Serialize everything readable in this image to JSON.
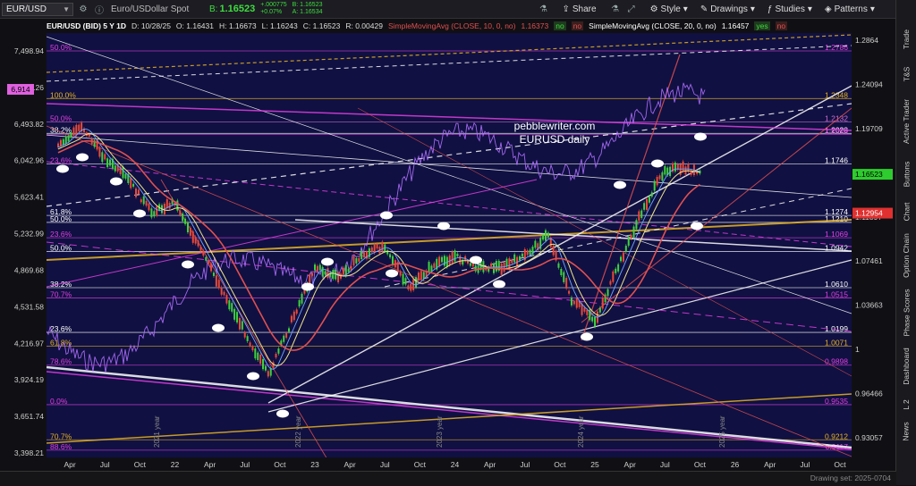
{
  "toolbar": {
    "symbol": "EUR/USD",
    "description": "Euro/USDollar Spot",
    "last_label": "B:",
    "last": "1.16523",
    "change": "+.000775",
    "change_pct": "+0.07%",
    "bid": "B: 1.16523",
    "ask": "A: 1.16534",
    "share": "Share",
    "style": "Style",
    "drawings": "Drawings",
    "studies": "Studies",
    "patterns": "Patterns"
  },
  "info": {
    "title": "EUR/USD (BID) 5 Y 1D",
    "date": "D: 10/28/25",
    "open": "O: 1.16431",
    "high": "H: 1.16673",
    "low": "L: 1.16243",
    "close": "C: 1.16523",
    "range": "R: 0.00429",
    "sma10": "SimpleMovingAvg (CLOSE, 10, 0, no)",
    "sma10_val": "1.16373",
    "sma20": "SimpleMovingAvg (CLOSE, 20, 0, no)",
    "sma20_val": "1.16457",
    "no1": "no",
    "no2": "no",
    "yes": "yes",
    "no3": "no"
  },
  "watermark": {
    "line1": "pebblewriter.com",
    "line2": "EURUSD daily"
  },
  "right_tabs": [
    "Trade",
    "T&S",
    "Active Trader",
    "Buttons",
    "Chart",
    "Option Chain",
    "Phase Scores",
    "Dashboard",
    "L 2",
    "News"
  ],
  "footer": {
    "drawing_set": "Drawing set: 2025-0704"
  },
  "colors": {
    "bg": "#101042",
    "candle_up": "#3fd23f",
    "candle_down": "#e84a3a",
    "sma10": "#6fa8ff",
    "sma20": "#f0e68c",
    "sma50": "#e05050",
    "spx": "#b070ff",
    "gold": "#e6b422",
    "white": "#ffffff",
    "magenta": "#e040e0"
  },
  "chart_data": {
    "type": "line",
    "series": [
      {
        "name": "EUR/USD",
        "x": [
          "2021-03",
          "2021-05",
          "2021-07",
          "2021-09",
          "2021-11",
          "2022-01",
          "2022-03",
          "2022-05",
          "2022-07",
          "2022-09",
          "2022-11",
          "2023-01",
          "2023-03",
          "2023-05",
          "2023-07",
          "2023-09",
          "2023-11",
          "2024-01",
          "2024-03",
          "2024-05",
          "2024-07",
          "2024-09",
          "2024-11",
          "2025-01",
          "2025-03",
          "2025-05",
          "2025-07",
          "2025-09",
          "2025-10"
        ],
        "values": [
          1.19,
          1.21,
          1.18,
          1.16,
          1.13,
          1.14,
          1.1,
          1.06,
          1.02,
          0.98,
          1.03,
          1.08,
          1.07,
          1.09,
          1.1,
          1.06,
          1.08,
          1.09,
          1.08,
          1.08,
          1.09,
          1.11,
          1.05,
          1.03,
          1.08,
          1.13,
          1.17,
          1.17,
          1.165
        ]
      }
    ],
    "right_axis_ticks": [
      "1.2864",
      "1.24094",
      "1.19709",
      "1.15478",
      "1.11397",
      "1.07461",
      "1.03663",
      "1",
      "0.96466",
      "0.93057"
    ],
    "left_axis_ticks": [
      "7,498.94",
      "6,878.26",
      "6,493.82",
      "6,042.96",
      "5,623.41",
      "5,232.99",
      "4,869.68",
      "4,531.58",
      "4,216.97",
      "3,924.19",
      "3,651.74",
      "3,398.21"
    ],
    "pink_label": "6,914",
    "x_ticks": [
      "Apr",
      "Jul",
      "Oct",
      "22",
      "Apr",
      "Jul",
      "Oct",
      "23",
      "Apr",
      "Jul",
      "Oct",
      "24",
      "Apr",
      "Jul",
      "Oct",
      "25",
      "Apr",
      "Jul",
      "Oct",
      "26",
      "Apr",
      "Jul",
      "Oct"
    ],
    "year_labels": [
      "2021 year",
      "2022 year",
      "2023 year",
      "2024 year",
      "2025 year"
    ],
    "price_levels": [
      {
        "label": "1.2786",
        "y": 1.2786,
        "color": "#e040e0"
      },
      {
        "label": "1.2348",
        "y": 1.2348,
        "color": "#e6b422"
      },
      {
        "label": "1.2132",
        "y": 1.2132,
        "color": "#d070d0"
      },
      {
        "label": "1.2028",
        "y": 1.2028,
        "color": "#ffffff"
      },
      {
        "label": "1.2018",
        "y": 1.2018,
        "color": "#e040e0"
      },
      {
        "label": "1.1746",
        "y": 1.1746,
        "color": "#ffffff"
      },
      {
        "label": "1.1274",
        "y": 1.1274,
        "color": "#ffffff"
      },
      {
        "label": "1.1210",
        "y": 1.121,
        "color": "#ffffff"
      },
      {
        "label": "1.1069",
        "y": 1.1069,
        "color": "#e040e0"
      },
      {
        "label": "1.0942",
        "y": 1.0942,
        "color": "#ffffff"
      },
      {
        "label": "1.0610",
        "y": 1.061,
        "color": "#ffffff"
      },
      {
        "label": "1.0515",
        "y": 1.0515,
        "color": "#e040e0"
      },
      {
        "label": "1.0199",
        "y": 1.0199,
        "color": "#ffffff"
      },
      {
        "label": "1.0071",
        "y": 1.0071,
        "color": "#e6b422"
      },
      {
        "label": "0.9898",
        "y": 0.9898,
        "color": "#e040e0"
      },
      {
        "label": "0.9535",
        "y": 0.9535,
        "color": "#e040e0"
      },
      {
        "label": "0.9212",
        "y": 0.9212,
        "color": "#e6b422"
      },
      {
        "label": "0.9117",
        "y": 0.9117,
        "color": "#e040e0"
      }
    ],
    "fib_labels": [
      {
        "label": "50.0%",
        "y": 1.2786,
        "color": "#e040e0"
      },
      {
        "label": "100.0%",
        "y": 1.2348,
        "color": "#e6b422"
      },
      {
        "label": "50.0%",
        "y": 1.2132,
        "color": "#e040e0"
      },
      {
        "label": "38.2%",
        "y": 1.2028,
        "color": "#ffffff"
      },
      {
        "label": "23.6%",
        "y": 1.1746,
        "color": "#e040e0"
      },
      {
        "label": "61.8%",
        "y": 1.1274,
        "color": "#ffffff"
      },
      {
        "label": "50.0%",
        "y": 1.121,
        "color": "#ffffff"
      },
      {
        "label": "23.6%",
        "y": 1.1069,
        "color": "#e040e0"
      },
      {
        "label": "50.0%",
        "y": 1.0942,
        "color": "#ffffff"
      },
      {
        "label": "38.2%",
        "y": 1.061,
        "color": "#ffffff"
      },
      {
        "label": "70.7%",
        "y": 1.0515,
        "color": "#e040e0"
      },
      {
        "label": "23.6%",
        "y": 1.0199,
        "color": "#ffffff"
      },
      {
        "label": "61.8%",
        "y": 1.0071,
        "color": "#e6b422"
      },
      {
        "label": "78.6%",
        "y": 0.9898,
        "color": "#e040e0"
      },
      {
        "label": "0.0%",
        "y": 0.9535,
        "color": "#e040e0"
      },
      {
        "label": "70.7%",
        "y": 0.9212,
        "color": "#e6b422"
      },
      {
        "label": "88.6%",
        "y": 0.9117,
        "color": "#e040e0"
      }
    ],
    "current_price_tag": "1.16523",
    "red_price_tag": "1.12954",
    "ylim": [
      0.905,
      1.295
    ],
    "grid": false
  }
}
